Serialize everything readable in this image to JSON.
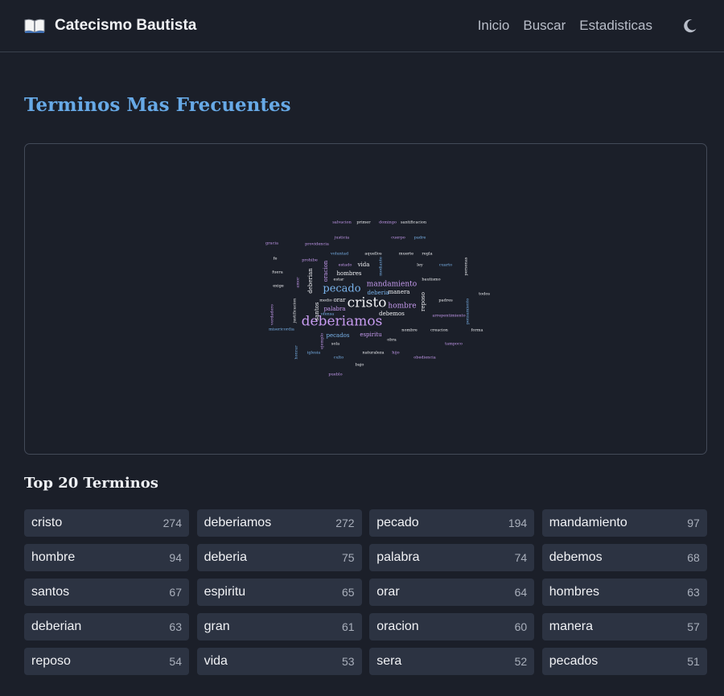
{
  "navbar": {
    "brand_title": "Catecismo Bautista",
    "brand_icon": "open-book-icon",
    "links": [
      "Inicio",
      "Buscar",
      "Estadisticas"
    ],
    "theme_icon": "moon-icon"
  },
  "page_title": "Terminos Mas Frecuentes",
  "word_cloud": {
    "words": [
      {
        "text": "deberiamos",
        "color": "#c79bf0",
        "weight": 5
      },
      {
        "text": "cristo",
        "color": "#f1f2f5",
        "weight": 5
      },
      {
        "text": "pecado",
        "color": "#7ab4ec",
        "weight": 4
      },
      {
        "text": "mandamiento",
        "color": "#c79bf0",
        "weight": 3
      },
      {
        "text": "hombre",
        "color": "#c79bf0",
        "weight": 3
      },
      {
        "text": "deberia",
        "color": "#7ab4ec",
        "weight": 2
      },
      {
        "text": "palabra",
        "color": "#c79bf0",
        "weight": 2
      },
      {
        "text": "debemos",
        "color": "#f1f2f5",
        "weight": 2
      },
      {
        "text": "santos",
        "color": "#f1f2f5",
        "weight": 2
      },
      {
        "text": "espiritu",
        "color": "#c79bf0",
        "weight": 2
      },
      {
        "text": "orar",
        "color": "#f1f2f5",
        "weight": 2
      },
      {
        "text": "hombres",
        "color": "#f1f2f5",
        "weight": 2
      },
      {
        "text": "deberian",
        "color": "#f1f2f5",
        "weight": 2
      },
      {
        "text": "oracion",
        "color": "#c79bf0",
        "weight": 2
      },
      {
        "text": "manera",
        "color": "#f1f2f5",
        "weight": 2
      },
      {
        "text": "reposo",
        "color": "#f1f2f5",
        "weight": 2
      },
      {
        "text": "vida",
        "color": "#f1f2f5",
        "weight": 2
      },
      {
        "text": "pecados",
        "color": "#7ab4ec",
        "weight": 2
      },
      {
        "text": "medio",
        "color": "#f1f2f5",
        "weight": 1
      },
      {
        "text": "estado",
        "color": "#c79bf0",
        "weight": 1
      },
      {
        "text": "voluntad",
        "color": "#7ab4ec",
        "weight": 1
      },
      {
        "text": "aquellos",
        "color": "#f1f2f5",
        "weight": 1
      },
      {
        "text": "muerte",
        "color": "#f1f2f5",
        "weight": 1
      },
      {
        "text": "regla",
        "color": "#f1f2f5",
        "weight": 1
      },
      {
        "text": "bautismo",
        "color": "#f1f2f5",
        "weight": 1
      },
      {
        "text": "obra",
        "color": "#f1f2f5",
        "weight": 1
      },
      {
        "text": "nombre",
        "color": "#f1f2f5",
        "weight": 1
      },
      {
        "text": "estar",
        "color": "#f1f2f5",
        "weight": 1
      },
      {
        "text": "cuerpo",
        "color": "#c79bf0",
        "weight": 1
      },
      {
        "text": "padre",
        "color": "#7ab4ec",
        "weight": 1
      },
      {
        "text": "justicia",
        "color": "#c79bf0",
        "weight": 1
      },
      {
        "text": "providencia",
        "color": "#c79bf0",
        "weight": 1
      },
      {
        "text": "iglesia",
        "color": "#7ab4ec",
        "weight": 1
      },
      {
        "text": "hijo",
        "color": "#c79bf0",
        "weight": 1
      },
      {
        "text": "pueblo",
        "color": "#c79bf0",
        "weight": 1
      },
      {
        "text": "prohibe",
        "color": "#c79bf0",
        "weight": 1
      },
      {
        "text": "sola",
        "color": "#f1f2f5",
        "weight": 1
      },
      {
        "text": "naturaleza",
        "color": "#f1f2f5",
        "weight": 1
      },
      {
        "text": "mediante",
        "color": "#7ab4ec",
        "weight": 1
      },
      {
        "text": "culto",
        "color": "#7ab4ec",
        "weight": 1
      },
      {
        "text": "salvacion",
        "color": "#c79bf0",
        "weight": 1
      },
      {
        "text": "primer",
        "color": "#f1f2f5",
        "weight": 1
      },
      {
        "text": "domingo",
        "color": "#c79bf0",
        "weight": 1
      },
      {
        "text": "santificacion",
        "color": "#f1f2f5",
        "weight": 1
      },
      {
        "text": "todos",
        "color": "#f1f2f5",
        "weight": 1
      },
      {
        "text": "forma",
        "color": "#f1f2f5",
        "weight": 1
      },
      {
        "text": "personas",
        "color": "#f1f2f5",
        "weight": 1
      },
      {
        "text": "ley",
        "color": "#f1f2f5",
        "weight": 1
      },
      {
        "text": "cuarto",
        "color": "#7ab4ec",
        "weight": 1
      },
      {
        "text": "arrepentimiento",
        "color": "#c79bf0",
        "weight": 1
      },
      {
        "text": "pensamiento",
        "color": "#7ab4ec",
        "weight": 1
      },
      {
        "text": "exige",
        "color": "#f1f2f5",
        "weight": 1
      },
      {
        "text": "ofensa",
        "color": "#7ab4ec",
        "weight": 1
      },
      {
        "text": "amor",
        "color": "#c79bf0",
        "weight": 1
      },
      {
        "text": "fe",
        "color": "#f1f2f5",
        "weight": 1
      },
      {
        "text": "gracia",
        "color": "#c79bf0",
        "weight": 1
      },
      {
        "text": "justificacion",
        "color": "#f1f2f5",
        "weight": 1
      },
      {
        "text": "ejemplo",
        "color": "#c79bf0",
        "weight": 1
      },
      {
        "text": "creacion",
        "color": "#f1f2f5",
        "weight": 1
      },
      {
        "text": "padres",
        "color": "#f1f2f5",
        "weight": 1
      },
      {
        "text": "tampoco",
        "color": "#c79bf0",
        "weight": 1
      },
      {
        "text": "obediencia",
        "color": "#c79bf0",
        "weight": 1
      },
      {
        "text": "misericordia",
        "color": "#7ab4ec",
        "weight": 1
      },
      {
        "text": "verdadero",
        "color": "#c79bf0",
        "weight": 1
      },
      {
        "text": "fuera",
        "color": "#f1f2f5",
        "weight": 1
      },
      {
        "text": "honrar",
        "color": "#7ab4ec",
        "weight": 1
      },
      {
        "text": "bajo",
        "color": "#f1f2f5",
        "weight": 1
      }
    ]
  },
  "top_terms": {
    "title": "Top 20 Terminos",
    "items": [
      {
        "word": "cristo",
        "count": "274"
      },
      {
        "word": "deberiamos",
        "count": "272"
      },
      {
        "word": "pecado",
        "count": "194"
      },
      {
        "word": "mandamiento",
        "count": "97"
      },
      {
        "word": "hombre",
        "count": "94"
      },
      {
        "word": "deberia",
        "count": "75"
      },
      {
        "word": "palabra",
        "count": "74"
      },
      {
        "word": "debemos",
        "count": "68"
      },
      {
        "word": "santos",
        "count": "67"
      },
      {
        "word": "espiritu",
        "count": "65"
      },
      {
        "word": "orar",
        "count": "64"
      },
      {
        "word": "hombres",
        "count": "63"
      },
      {
        "word": "deberian",
        "count": "63"
      },
      {
        "word": "gran",
        "count": "61"
      },
      {
        "word": "oracion",
        "count": "60"
      },
      {
        "word": "manera",
        "count": "57"
      },
      {
        "word": "reposo",
        "count": "54"
      },
      {
        "word": "vida",
        "count": "53"
      },
      {
        "word": "sera",
        "count": "52"
      },
      {
        "word": "pecados",
        "count": "51"
      }
    ]
  }
}
